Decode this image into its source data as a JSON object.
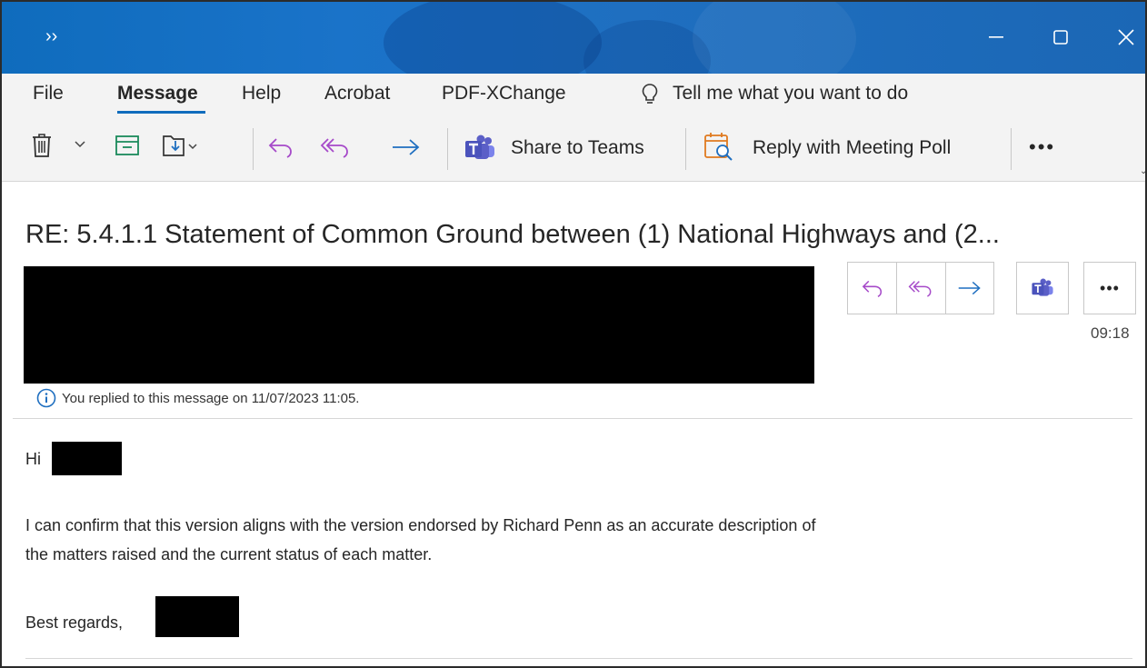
{
  "window": {
    "overflow_chevron": "››",
    "icons": {
      "minimize": "minimize-icon",
      "maximize": "maximize-icon",
      "close": "close-icon"
    },
    "accent_color": "#0f6cbd"
  },
  "menu": {
    "items": [
      {
        "label": "File",
        "active": false
      },
      {
        "label": "Message",
        "active": true
      },
      {
        "label": "Help",
        "active": false
      },
      {
        "label": "Acrobat",
        "active": false
      },
      {
        "label": "PDF-XChange",
        "active": false
      }
    ],
    "search_label": "Tell me what you want to do"
  },
  "toolbar": {
    "icons": [
      "delete-icon",
      "chevron-down-icon",
      "archive-icon",
      "move-icon",
      "reply-icon",
      "reply-all-icon",
      "forward-icon",
      "teams-icon",
      "meeting-poll-icon"
    ],
    "share_label": "Share to Teams",
    "poll_label": "Reply with Meeting Poll",
    "more_label": "•••"
  },
  "message": {
    "subject": "RE: 5.4.1.1 Statement of Common Ground between (1) National Highways and (2...",
    "time": "09:18",
    "more_label": "•••",
    "info_text": "You replied to this message on 11/07/2023 11:05.",
    "greeting": "Hi",
    "body_line1": "I can confirm that this version aligns with the version endorsed by Richard Penn as an accurate description of",
    "body_line2": "the matters raised and the current status of each matter.",
    "signoff": "Best regards,"
  }
}
